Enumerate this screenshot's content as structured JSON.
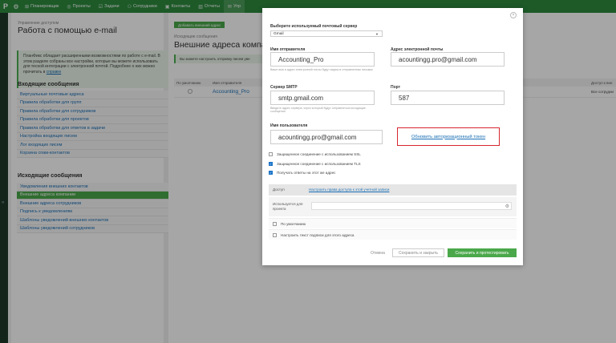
{
  "nav": {
    "items": [
      {
        "icon": "puzzle-icon",
        "glyph": "⊞",
        "label": "Планировщик"
      },
      {
        "icon": "target-icon",
        "glyph": "◎",
        "label": "Проекты"
      },
      {
        "icon": "checklist-icon",
        "glyph": "☑",
        "label": "Задачи"
      },
      {
        "icon": "people-icon",
        "glyph": "⚇",
        "label": "Сотрудники"
      },
      {
        "icon": "contacts-icon",
        "glyph": "▣",
        "label": "Контакты"
      },
      {
        "icon": "chart-icon",
        "glyph": "▥",
        "label": "Отчеты"
      },
      {
        "icon": "mail-icon",
        "glyph": "✉",
        "label": "Упр"
      }
    ]
  },
  "left": {
    "breadcrumb": "Управление доступом",
    "title": "Работа с помощью e-mail",
    "info": "ПланФикс обладает расширенными возможностями по работе с e-mail. В этом разделе собраны все настройки, которые вы можете использовать для тесной интеграции с электронной почтой. Подробнее о них можно прочитать в",
    "info_link": "справке",
    "incoming_title": "Входящие сообщения",
    "incoming": [
      "Виртуальные почтовые адреса",
      "Правила обработки для групп",
      "Правила обработки для сотрудников",
      "Правила обработки для проектов",
      "Правила обработки для ответов в задачи",
      "Настройка входящих писем",
      "Лог входящих писем",
      "Корзина спам-контактов"
    ],
    "outgoing_title": "Исходящие сообщения",
    "outgoing": [
      "Уведомления внешних контактов",
      "Внешние адреса компании",
      "Внешние адреса сотрудников",
      "Подпись к уведомлениям",
      "Шаблоны уведомлений внешних контактов",
      "Шаблоны уведомлений сотрудников"
    ]
  },
  "main": {
    "add_button": "Добавить внешний адрес",
    "breadcrumb": "Исходящие сообщения",
    "title": "Внешние адреса компан",
    "notice": "Вы можете настроить отправку писем уве",
    "col_default": "По умолчанию",
    "col_sender": "Имя отправителя",
    "col_access": "Доступ к вне",
    "row_name": "Accounting_Pro",
    "row_access": "Все сотрудни"
  },
  "modal": {
    "server_label": "Выберите используемый почтовый сервер",
    "server_value": "Gmail",
    "sender_name_label": "Имя отправителя",
    "sender_name_value": "Accounting_Pro",
    "sender_name_hint": "Ваше имя и адрес электронной почты будут видны в отправленных письмах",
    "email_label": "Адрес электронной почты",
    "email_value": "acountingg.pro@gmail.com",
    "smtp_label": "Сервер SMTP",
    "smtp_value": "smtp.gmail.com",
    "smtp_hint": "Введите адрес сервера, через который будут отправляться исходящие сообщения",
    "port_label": "Порт",
    "port_value": "587",
    "user_label": "Имя пользователя",
    "user_value": "acountingg.pro@gmail.com",
    "token_link": "Обновить авторизационный токен",
    "ssl_label": "Защищенное соединение с использованием SSL",
    "tls_label": "Защищенное соединение с использованием TLS",
    "reply_label": "Получать ответы на этот же адрес",
    "access_label": "Доступ",
    "access_link": "Настроить права доступа к этой учетной записи",
    "used_label": "Используется для проекта",
    "default_label": "По умолчанию",
    "signature_label": "Настроить текст подписи для этого адреса",
    "cancel": "Отмена",
    "save_close": "Сохранить и закрыть",
    "save_test": "Сохранить и протестировать"
  }
}
